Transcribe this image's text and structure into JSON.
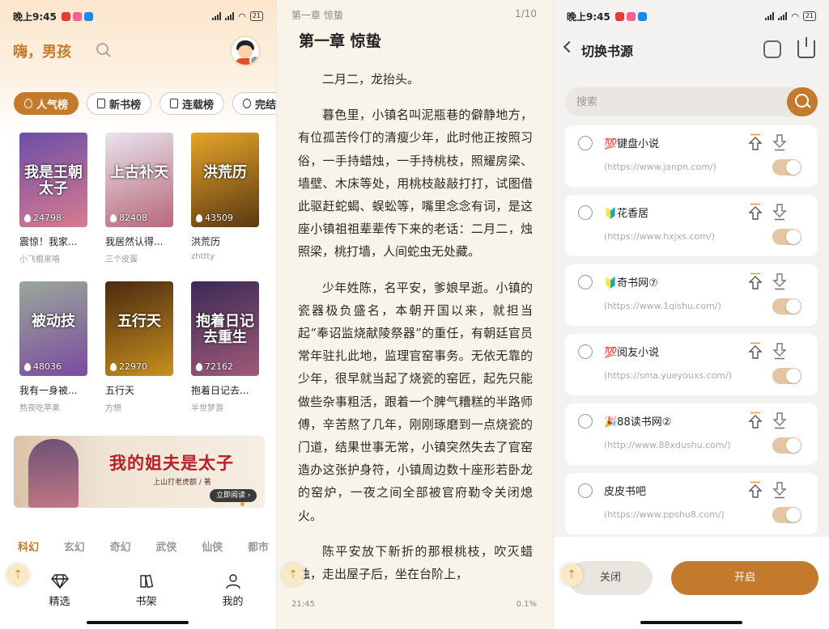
{
  "status": {
    "time": "晚上9:45",
    "battery": "21",
    "icon_colors": [
      "#e53935",
      "#f06292",
      "#1e88e5"
    ]
  },
  "home": {
    "greeting": "嗨，男孩",
    "chips": [
      {
        "label": "人气榜",
        "icon": "flame-icon",
        "active": true
      },
      {
        "label": "新书榜",
        "icon": "book-icon",
        "active": false
      },
      {
        "label": "连载榜",
        "icon": "bookmark-icon",
        "active": false
      },
      {
        "label": "完结",
        "icon": "check-circle-icon",
        "active": false
      }
    ],
    "books": [
      {
        "cover_text": "我是王朝太子",
        "heat": "24798",
        "title": "震惊！我家...",
        "author": "小飞棍来咯",
        "c1": "#6b4ea8",
        "c2": "#d97b8f"
      },
      {
        "cover_text": "上古补天",
        "heat": "82408",
        "title": "我居然认得...",
        "author": "三个皮蛋",
        "c1": "#e9e3ee",
        "c2": "#b86878"
      },
      {
        "cover_text": "洪荒历",
        "heat": "43509",
        "title": "洪荒历",
        "author": "zhttty",
        "c1": "#e6a52a",
        "c2": "#5a3812"
      },
      {
        "cover_text": "被动技",
        "heat": "48036",
        "title": "我有一身被...",
        "author": "熬夜吃苹果",
        "c1": "#9aa89a",
        "c2": "#7c4aa0"
      },
      {
        "cover_text": "五行天",
        "heat": "22970",
        "title": "五行天",
        "author": "方想",
        "c1": "#4a2a10",
        "c2": "#c8901e"
      },
      {
        "cover_text": "抱着日记去重生",
        "heat": "72162",
        "title": "抱着日记去...",
        "author": "半世梦游",
        "c1": "#3a2a55",
        "c2": "#a05a78"
      }
    ],
    "banner": {
      "title": "我的姐夫是太子",
      "subtitle": "上山打老虎额 / 著",
      "button": "立即阅读 ›"
    },
    "genres": [
      "科幻",
      "玄幻",
      "奇幻",
      "武侠",
      "仙侠",
      "都市"
    ],
    "active_genre": 0,
    "tabs": [
      {
        "label": "精选",
        "icon": "diamond-icon"
      },
      {
        "label": "书架",
        "icon": "bookshelf-icon"
      },
      {
        "label": "我的",
        "icon": "person-icon"
      }
    ],
    "fab_icon": "up-arrow-icon"
  },
  "reader": {
    "header": "第一章 惊蛰",
    "page": "1/10",
    "chapter_title": "第一章  惊蛰",
    "paragraphs": [
      "二月二，龙抬头。",
      "暮色里，小镇名叫泥瓶巷的僻静地方，有位孤苦伶仃的清瘦少年，此时他正按照习俗，一手持蜡烛，一手持桃枝，照耀房梁、墙壁、木床等处，用桃枝敲敲打打，试图借此驱赶蛇蝎、蜈蚣等，嘴里念念有词，是这座小镇祖祖辈辈传下来的老话：二月二，烛照梁，桃打墙，人间蛇虫无处藏。",
      "少年姓陈，名平安，爹娘早逝。小镇的瓷器极负盛名，本朝开国以来，就担当起“奉诏监烧献陵祭器”的重任，有朝廷官员常年驻扎此地，监理官窑事务。无依无靠的少年，很早就当起了烧瓷的窑匠，起先只能做些杂事粗活，跟着一个脾气糟糕的半路师傅，辛苦熬了几年，刚刚琢磨到一点烧瓷的门道，结果世事无常，小镇突然失去了官窑造办这张护身符，小镇周边数十座形若卧龙的窑炉，一夜之间全部被官府勒令关闭熄火。",
      "陈平安放下新折的那根桃枝，吹灭蜡烛，走出屋子后，坐在台阶上，"
    ],
    "time": "21:45",
    "progress": "0.1%"
  },
  "sources": {
    "title": "切换书源",
    "search_placeholder": "搜索",
    "items": [
      {
        "name": "💯键盘小说",
        "url": "(https://www.janpn.com/)",
        "enabled": true
      },
      {
        "name": "🔰花香居",
        "url": "(https://www.hxjxs.com/)",
        "enabled": true
      },
      {
        "name": "🔰奇书网⑦",
        "url": "(https://www.1qishu.com/)",
        "enabled": true
      },
      {
        "name": "💯阅友小说",
        "url": "(https://sma.yueyouxs.com/)",
        "enabled": true
      },
      {
        "name": "🎉88读书网②",
        "url": "(http://www.88xdushu.com/)",
        "enabled": true
      },
      {
        "name": "皮皮书吧",
        "url": "(https://www.ppshu8.com/)",
        "enabled": true
      }
    ],
    "close_label": "关闭",
    "open_label": "开启"
  }
}
